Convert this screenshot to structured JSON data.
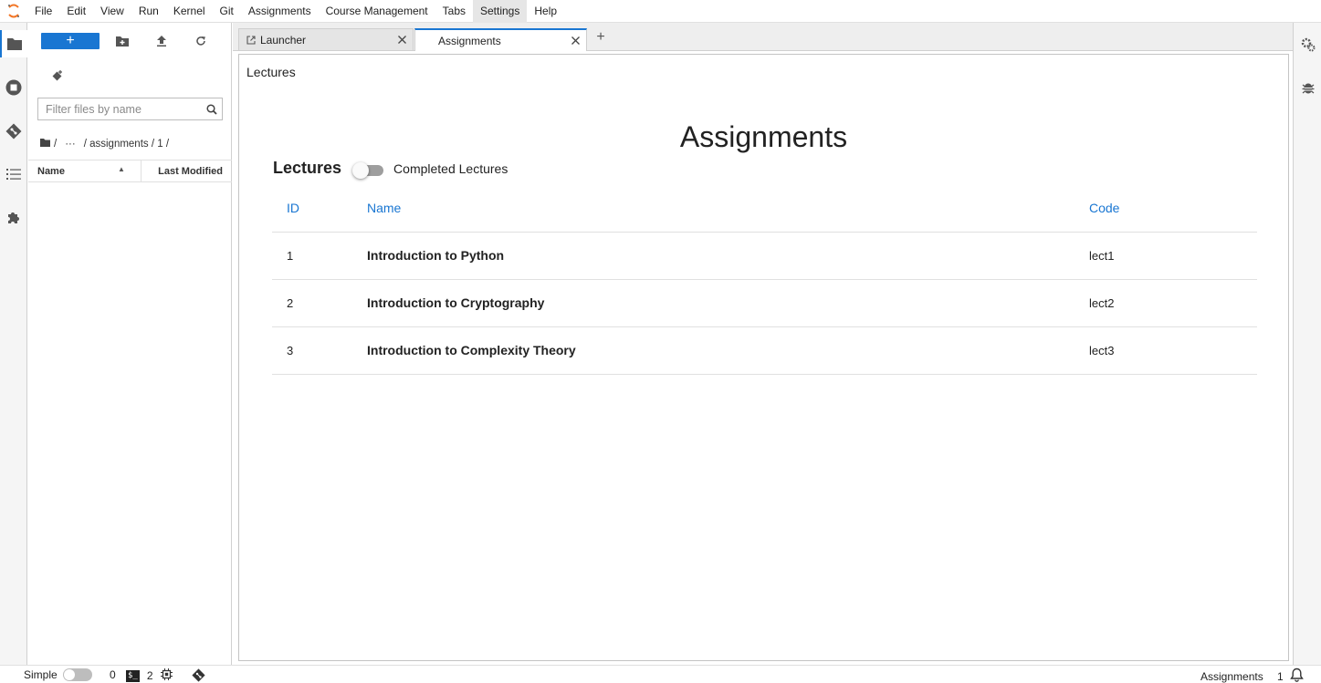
{
  "menu": [
    "File",
    "Edit",
    "View",
    "Run",
    "Kernel",
    "Git",
    "Assignments",
    "Course Management",
    "Tabs",
    "Settings",
    "Help"
  ],
  "file_browser": {
    "new_label": "+",
    "filter_placeholder": "Filter files by name",
    "breadcrumb": [
      "/",
      "···",
      "/ assignments / 1 /"
    ],
    "col_name": "Name",
    "col_modified": "Last Modified"
  },
  "tabs": [
    {
      "label": "Launcher"
    },
    {
      "label": "Assignments"
    }
  ],
  "main": {
    "heading": "Lectures",
    "title": "Assignments",
    "subtitle": "Lectures",
    "toggle_label": "Completed Lectures",
    "table": {
      "headers": {
        "id": "ID",
        "name": "Name",
        "code": "Code"
      },
      "rows": [
        {
          "id": "1",
          "name": "Introduction to Python",
          "code": "lect1"
        },
        {
          "id": "2",
          "name": "Introduction to Cryptography",
          "code": "lect2"
        },
        {
          "id": "3",
          "name": "Introduction to Complexity Theory",
          "code": "lect3"
        }
      ]
    }
  },
  "status": {
    "mode": "Simple",
    "kernels": "0",
    "terminal_badge": "$_",
    "terminals": "2",
    "right_label": "Assignments",
    "right_count": "1"
  },
  "colors": {
    "accent": "#1976d2",
    "logo": "#f37626"
  }
}
